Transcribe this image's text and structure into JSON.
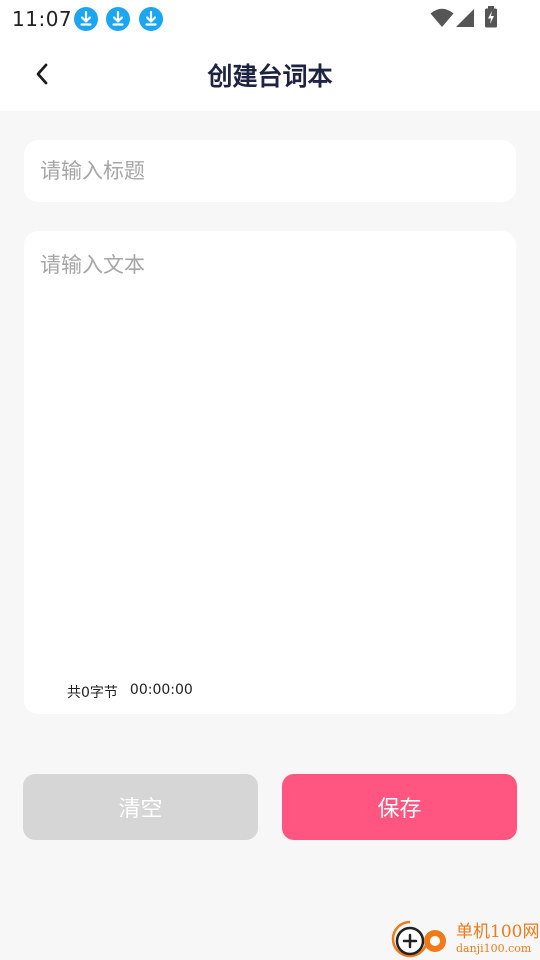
{
  "status_bar": {
    "time": "11:07",
    "notification_icons": [
      "download-icon",
      "download-icon",
      "download-icon"
    ],
    "system_icons": [
      "wifi-icon",
      "signal-icon",
      "battery-charging-icon"
    ],
    "accent_color": "#1aa6f0"
  },
  "header": {
    "back_icon": "back-arrow-icon",
    "title": "创建台词本"
  },
  "form": {
    "title_placeholder": "请输入标题",
    "title_value": "",
    "text_placeholder": "请输入文本",
    "text_value": "",
    "char_count_text": "共0字节",
    "duration_text": "00:00:00"
  },
  "actions": {
    "clear_label": "清空",
    "save_label": "保存",
    "clear_color": "#d6d6d6",
    "save_color": "#ff5580"
  },
  "watermark": {
    "cn": "单机100网",
    "en": "danji100.com"
  }
}
